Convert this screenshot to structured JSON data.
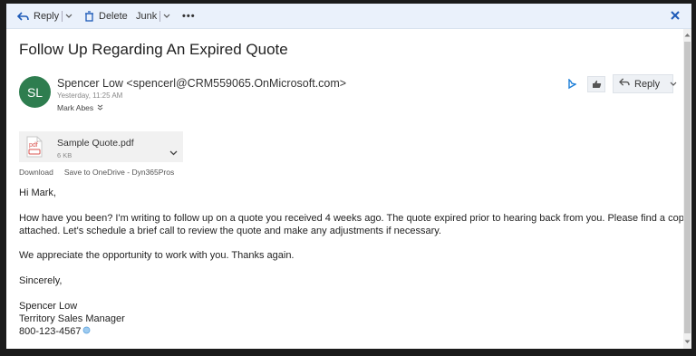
{
  "toolbar": {
    "reply_label": "Reply",
    "delete_label": "Delete",
    "junk_label": "Junk",
    "more_label": "•••"
  },
  "email": {
    "subject": "Follow Up Regarding An Expired Quote",
    "avatar_initials": "SL",
    "avatar_color": "#2e7d4f",
    "sender": "Spencer Low <spencerl@CRM559065.OnMicrosoft.com>",
    "date": "Yesterday, 11:25 AM",
    "recipient": "Mark Abes",
    "reply_button": "Reply",
    "attachment": {
      "name": "Sample Quote.pdf",
      "size": "6 KB",
      "icon_text": "pdf",
      "download": "Download",
      "save": "Save to OneDrive - Dyn365Pros"
    },
    "body": {
      "greeting": "Hi Mark,",
      "para1_line1": "How have you been? I'm writing to follow up on a quote you received 4 weeks ago. The quote expired prior to hearing back from you. Please find a copy",
      "para1_line2": "attached. Let's schedule a brief call to review the quote and make any adjustments if necessary.",
      "para2": "We appreciate the opportunity to work with you. Thanks again.",
      "closing": "Sincerely,",
      "sig_name": "Spencer Low",
      "sig_title": "Territory Sales Manager",
      "sig_phone": "800-123-4567"
    }
  },
  "colors": {
    "accent": "#1e5bb8",
    "toolbar_bg": "#eaf1fb"
  }
}
